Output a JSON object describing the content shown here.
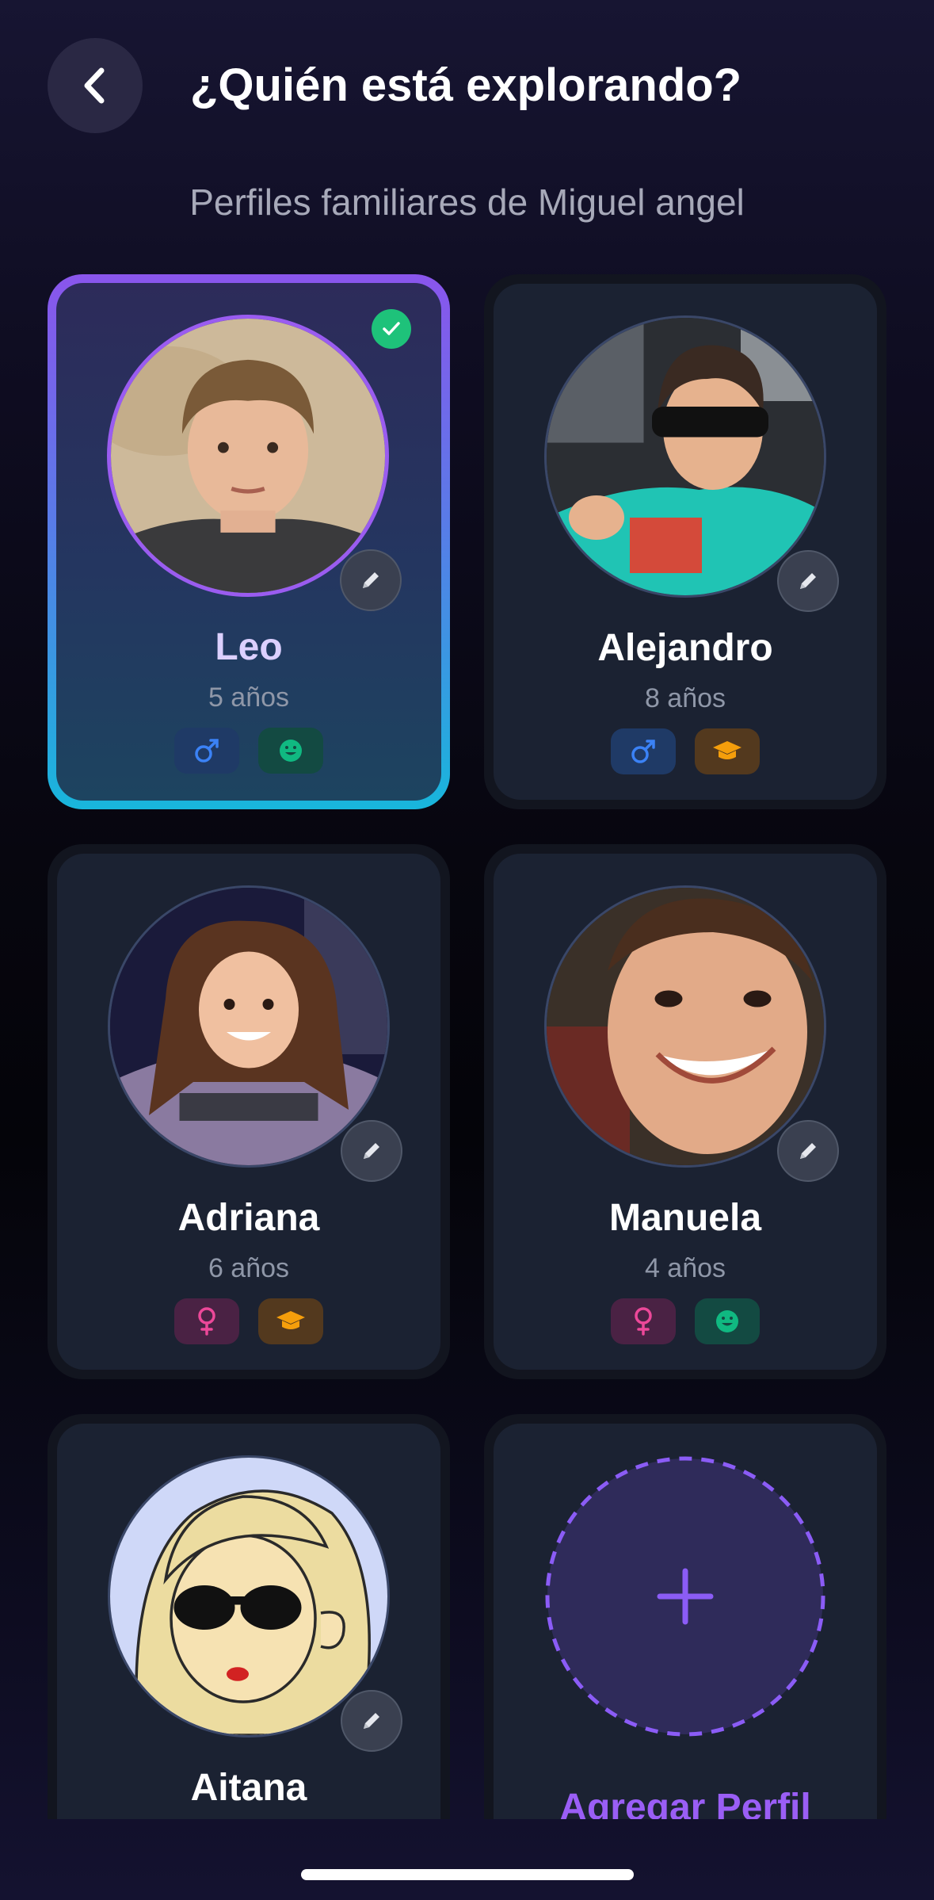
{
  "header": {
    "back_icon": "chevron-left-icon",
    "title": "¿Quién está explorando?",
    "subtitle": "Perfiles familiares de Miguel angel"
  },
  "profiles": [
    {
      "name": "Leo",
      "age": "5 años",
      "selected": true,
      "badges": [
        "male-icon",
        "happy-face-icon"
      ]
    },
    {
      "name": "Alejandro",
      "age": "8 años",
      "selected": false,
      "badges": [
        "male-icon",
        "graduation-cap-icon"
      ]
    },
    {
      "name": "Adriana",
      "age": "6 años",
      "selected": false,
      "badges": [
        "female-icon",
        "graduation-cap-icon"
      ]
    },
    {
      "name": "Manuela",
      "age": "4 años",
      "selected": false,
      "badges": [
        "female-icon",
        "happy-face-icon"
      ]
    },
    {
      "name": "Aitana",
      "age": "",
      "selected": false,
      "badges": []
    }
  ],
  "add_profile": {
    "label": "Agregar Perfil",
    "icon": "plus-icon"
  },
  "colors": {
    "accent_purple": "#8a55ec",
    "accent_cyan": "#18b6dc",
    "check_green": "#1ec27a",
    "male_blue": "#3b82f6",
    "female_pink": "#ec4899",
    "happy_green": "#10b981",
    "school_orange": "#f59e0b"
  }
}
